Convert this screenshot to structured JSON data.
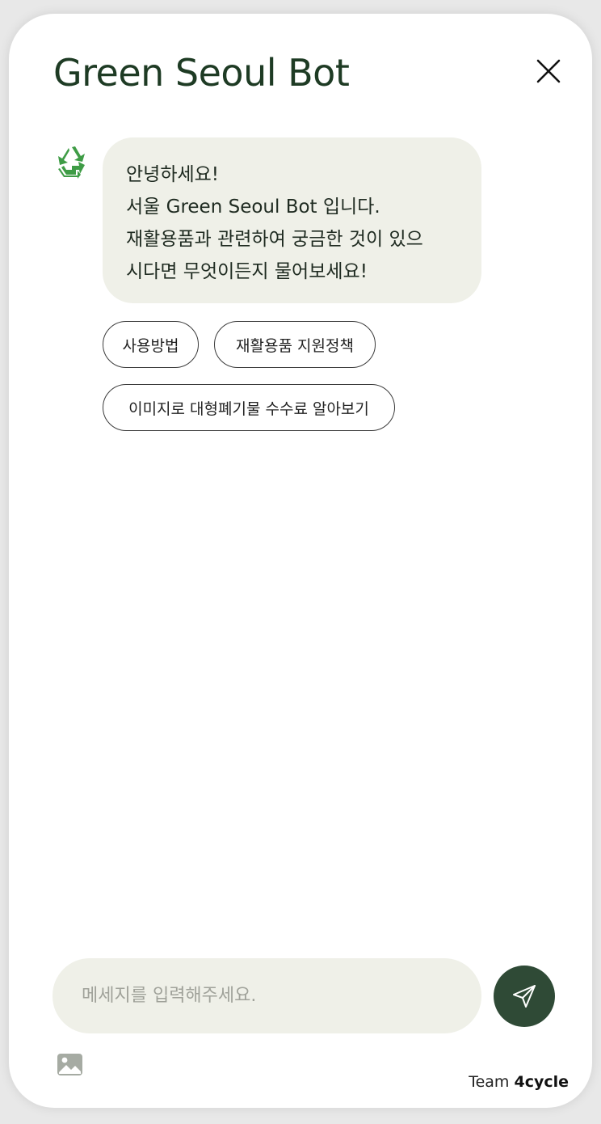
{
  "header": {
    "title": "Green Seoul Bot",
    "close_icon": "close-icon"
  },
  "bot": {
    "avatar_icon": "recycle-icon",
    "message_lines": [
      "안녕하세요!",
      "서울 Green Seoul Bot 입니다.",
      "재활용품과 관련하여 궁금한 것이 있으",
      "시다면 무엇이든지 물어보세요!"
    ]
  },
  "quick_replies": [
    "사용방법",
    "재활용품 지원정책",
    "이미지로 대형폐기물 수수료 알아보기"
  ],
  "composer": {
    "placeholder": "메세지를 입력해주세요.",
    "send_icon": "send-icon",
    "image_icon": "image-icon"
  },
  "footer": {
    "team_prefix": "Team",
    "team_name": "4cycle"
  },
  "colors": {
    "title": "#1e3b24",
    "bubble": "#eff0e8",
    "send_button": "#2f4a36",
    "recycle_icon": "#3f9c46"
  }
}
